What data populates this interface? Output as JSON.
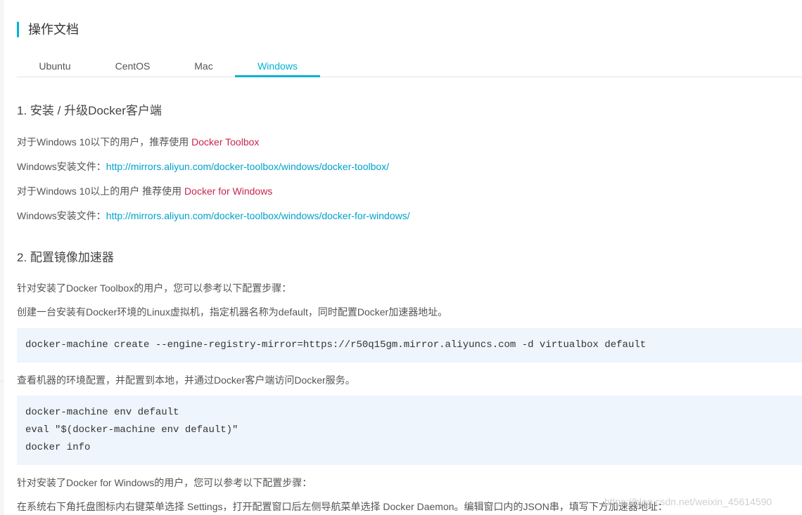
{
  "page_title": "操作文档",
  "tabs": [
    {
      "label": "Ubuntu",
      "active": false
    },
    {
      "label": "CentOS",
      "active": false
    },
    {
      "label": "Mac",
      "active": false
    },
    {
      "label": "Windows",
      "active": true
    }
  ],
  "colors": {
    "accent": "#00b3d6",
    "link_red": "#c7254e",
    "link_blue": "#00a2ca",
    "code_bg": "#eef5fc"
  },
  "section1": {
    "heading": "1. 安装 / 升级Docker客户端",
    "line1_text": "对于Windows 10以下的用户，推荐使用 ",
    "line1_link": "Docker Toolbox",
    "line2_text": "Windows安装文件：",
    "line2_link": "http://mirrors.aliyun.com/docker-toolbox/windows/docker-toolbox/",
    "line3_text": "对于Windows 10以上的用户 推荐使用 ",
    "line3_link": "Docker for Windows",
    "line4_text": "Windows安装文件：",
    "line4_link": "http://mirrors.aliyun.com/docker-toolbox/windows/docker-for-windows/"
  },
  "section2": {
    "heading": "2. 配置镜像加速器",
    "para1": "针对安装了Docker Toolbox的用户，您可以参考以下配置步骤：",
    "para2": "创建一台安装有Docker环境的Linux虚拟机，指定机器名称为default，同时配置Docker加速器地址。",
    "code1": [
      "docker-machine create --engine-registry-mirror=https://r50q15gm.mirror.aliyuncs.com -d virtualbox default"
    ],
    "para3": "查看机器的环境配置，并配置到本地，并通过Docker客户端访问Docker服务。",
    "code2": [
      "docker-machine env default",
      "eval \"$(docker-machine env default)\"",
      "docker info"
    ],
    "para4": "针对安装了Docker for Windows的用户，您可以参考以下配置步骤：",
    "para5": "在系统右下角托盘图标内右键菜单选择 Settings，打开配置窗口后左侧导航菜单选择 Docker Daemon。编辑窗口内的JSON串，填写下方加速器地址："
  },
  "watermark": "https://blog.csdn.net/weixin_45614590"
}
